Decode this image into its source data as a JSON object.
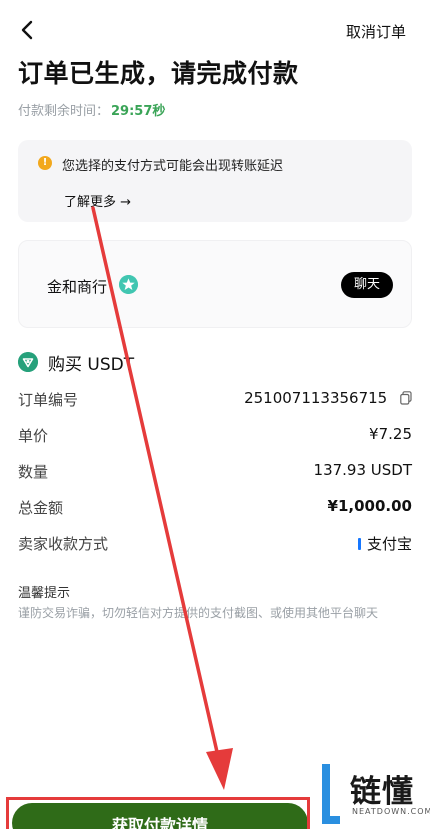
{
  "header": {
    "cancel_label": "取消订单"
  },
  "title": "订单已生成，请完成付款",
  "timer": {
    "label": "付款剩余时间：",
    "value": "29:57秒"
  },
  "notice": {
    "text": "您选择的支付方式可能会出现转账延迟",
    "link": "了解更多 →"
  },
  "merchant": {
    "name": "金和商行",
    "chat_label": "聊天"
  },
  "order": {
    "title": "购买 USDT",
    "rows": [
      {
        "key": "订单编号",
        "value": "251007113356715"
      },
      {
        "key": "单价",
        "value": "¥7.25"
      },
      {
        "key": "数量",
        "value": "137.93 USDT"
      },
      {
        "key": "总金额",
        "value": "¥1,000.00"
      },
      {
        "key": "卖家收款方式",
        "value": "支付宝"
      }
    ]
  },
  "tips": {
    "title": "温馨提示",
    "body": "谨防交易诈骗，切勿轻信对方提供的支付截图、或使用其他平台聊天"
  },
  "bottom": {
    "pay_label": "获取付款详情"
  },
  "watermark": {
    "text": "链懂",
    "sub": "NEATDOWN.COM"
  },
  "colors": {
    "accent_green": "#3aa457",
    "button_green": "#2f6b18",
    "annotation_red": "#e53b3b",
    "warning_orange": "#f2a81d"
  }
}
